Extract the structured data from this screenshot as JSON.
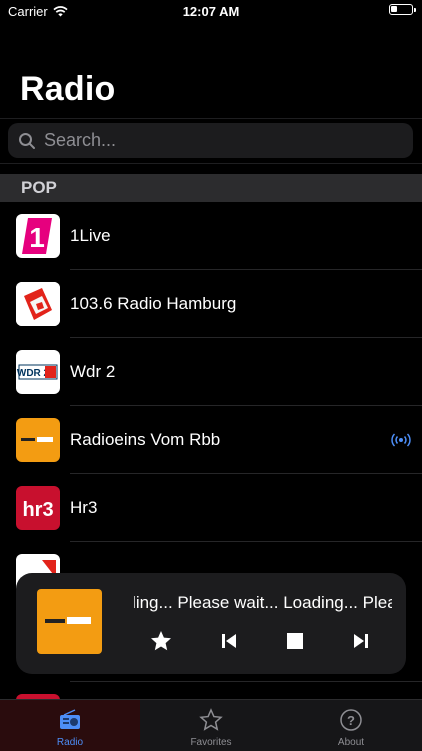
{
  "status_bar": {
    "carrier": "Carrier",
    "time": "12:07 AM"
  },
  "page": {
    "title": "Radio"
  },
  "search": {
    "placeholder": "Search..."
  },
  "section": {
    "title": "POP"
  },
  "stations": [
    {
      "name": "1Live",
      "logo_icon": "1live-logo"
    },
    {
      "name": "103.6 Radio Hamburg",
      "logo_icon": "radio-hamburg-logo"
    },
    {
      "name": "Wdr 2",
      "logo_icon": "wdr2-logo",
      "logo_text": "WDR 2"
    },
    {
      "name": "Radioeins Vom Rbb",
      "logo_icon": "radioeins-logo",
      "now_playing": true
    },
    {
      "name": "Hr3",
      "logo_icon": "hr3-logo",
      "logo_text": "hr3"
    }
  ],
  "player": {
    "status_text": "Loading... Please wait... Loading... Please wait...",
    "art_icon": "radioeins-logo",
    "controls": [
      "favorite-star-icon",
      "previous-icon",
      "stop-icon",
      "next-icon"
    ]
  },
  "tabs": [
    {
      "label": "Radio",
      "icon": "radio-icon",
      "active": true
    },
    {
      "label": "Favorites",
      "icon": "star-icon",
      "active": false
    },
    {
      "label": "About",
      "icon": "question-circle-icon",
      "active": false
    }
  ],
  "colors": {
    "accent": "#4d8ef7",
    "radioeins_orange": "#f39c12",
    "hr3_red": "#c8102e",
    "oneLive_pink": "#e6007e"
  }
}
